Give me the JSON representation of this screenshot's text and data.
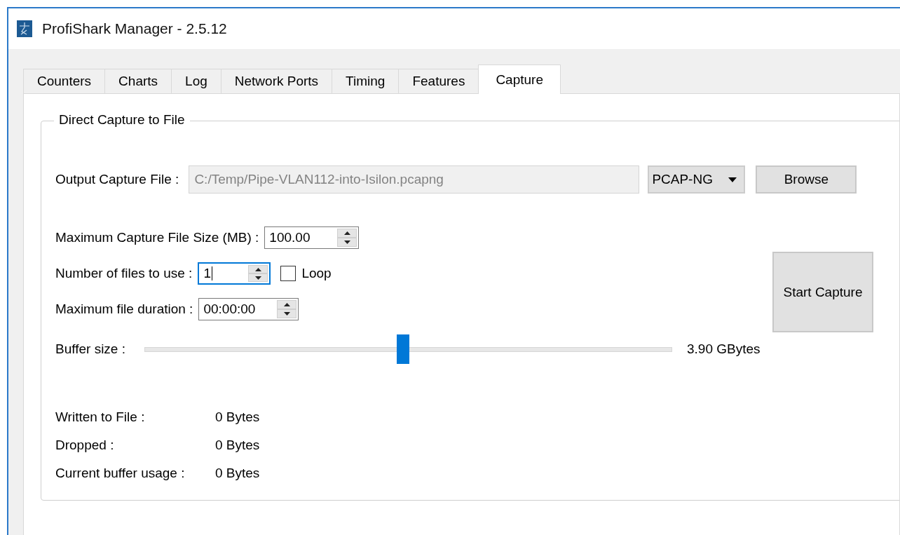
{
  "window": {
    "title": "ProfiShark Manager - 2.5.12"
  },
  "tabs": [
    {
      "label": "Counters",
      "selected": false
    },
    {
      "label": "Charts",
      "selected": false
    },
    {
      "label": "Log",
      "selected": false
    },
    {
      "label": "Network Ports",
      "selected": false
    },
    {
      "label": "Timing",
      "selected": false
    },
    {
      "label": "Features",
      "selected": false
    },
    {
      "label": "Capture",
      "selected": true
    }
  ],
  "group": {
    "title": "Direct Capture to File",
    "output_file": {
      "label": "Output Capture File :",
      "value": "C:/Temp/Pipe-VLAN112-into-Isilon.pcapng",
      "disabled": true
    },
    "format": {
      "value": "PCAP-NG"
    },
    "browse_button": "Browse",
    "spin_fields": [
      {
        "label": "Maximum Capture File Size (MB) :",
        "value": "100.00",
        "focused": false
      },
      {
        "label": "Number of files to use :",
        "value": "1",
        "focused": true,
        "checkbox": {
          "label": "Loop",
          "checked": false
        }
      },
      {
        "label": "Maximum file duration :",
        "value": "00:00:00",
        "focused": false
      }
    ],
    "start_button": "Start Capture",
    "buffer": {
      "label": "Buffer size :",
      "level": 0.49,
      "reading": "3.90 GBytes"
    },
    "stats": [
      {
        "label": "Written to File :",
        "value": "0 Bytes"
      },
      {
        "label": "Dropped :",
        "value": "0 Bytes"
      },
      {
        "label": "Current buffer usage :",
        "value": "0 Bytes"
      }
    ]
  }
}
